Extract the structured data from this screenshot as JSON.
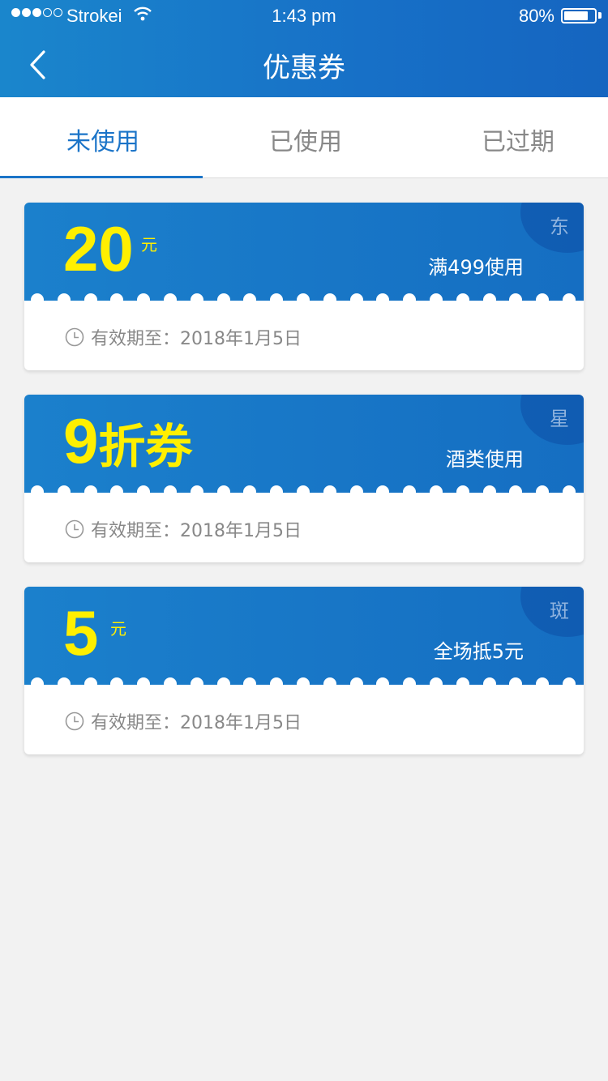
{
  "status_bar": {
    "carrier": "Strokei",
    "time": "1:43 pm",
    "battery_text": "80%",
    "battery_level": 0.8,
    "signal_bars_filled": 3,
    "signal_bars_total": 5
  },
  "header": {
    "title": "优惠券",
    "back_icon": "chevron-left-icon"
  },
  "tabs": [
    {
      "label": "未使用",
      "active": true
    },
    {
      "label": "已使用",
      "active": false
    },
    {
      "label": "已过期",
      "active": false
    }
  ],
  "coupons": [
    {
      "amount": "20",
      "unit": "元",
      "condition": "满499使用",
      "corner": "东",
      "expiry": "有效期至：2018年1月5日"
    },
    {
      "amount": "9",
      "amount_suffix": "折券",
      "condition": "酒类使用",
      "corner": "星",
      "expiry": "有效期至：2018年1月5日"
    },
    {
      "amount": "5",
      "unit": "元",
      "condition": "全场抵5元",
      "corner": "斑",
      "expiry": "有效期至：2018年1月5日"
    }
  ],
  "colors": {
    "header_bg": "#1770c7",
    "accent": "#1b74c8",
    "amount": "#ffef00",
    "page_bg": "#f2f2f2"
  }
}
